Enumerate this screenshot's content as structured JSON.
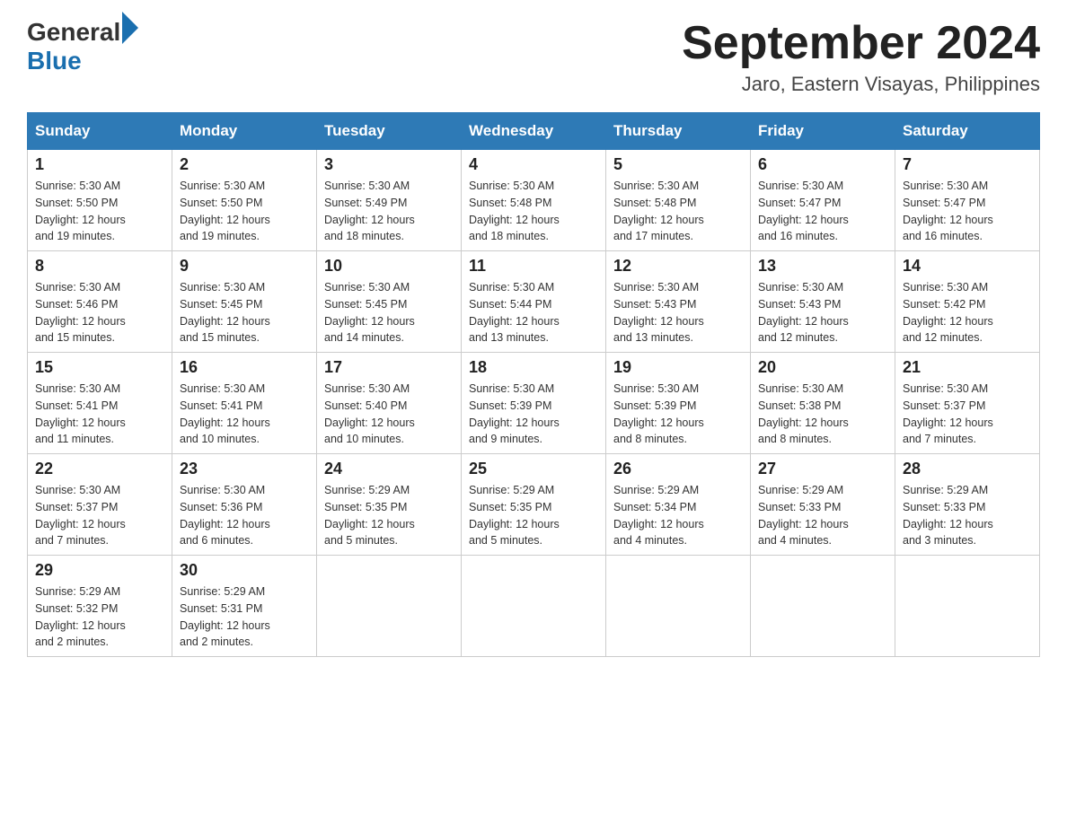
{
  "header": {
    "logo_general": "General",
    "logo_blue": "Blue",
    "title": "September 2024",
    "subtitle": "Jaro, Eastern Visayas, Philippines"
  },
  "columns": [
    "Sunday",
    "Monday",
    "Tuesday",
    "Wednesday",
    "Thursday",
    "Friday",
    "Saturday"
  ],
  "weeks": [
    [
      {
        "day": "1",
        "sunrise": "5:30 AM",
        "sunset": "5:50 PM",
        "daylight": "12 hours and 19 minutes."
      },
      {
        "day": "2",
        "sunrise": "5:30 AM",
        "sunset": "5:50 PM",
        "daylight": "12 hours and 19 minutes."
      },
      {
        "day": "3",
        "sunrise": "5:30 AM",
        "sunset": "5:49 PM",
        "daylight": "12 hours and 18 minutes."
      },
      {
        "day": "4",
        "sunrise": "5:30 AM",
        "sunset": "5:48 PM",
        "daylight": "12 hours and 18 minutes."
      },
      {
        "day": "5",
        "sunrise": "5:30 AM",
        "sunset": "5:48 PM",
        "daylight": "12 hours and 17 minutes."
      },
      {
        "day": "6",
        "sunrise": "5:30 AM",
        "sunset": "5:47 PM",
        "daylight": "12 hours and 16 minutes."
      },
      {
        "day": "7",
        "sunrise": "5:30 AM",
        "sunset": "5:47 PM",
        "daylight": "12 hours and 16 minutes."
      }
    ],
    [
      {
        "day": "8",
        "sunrise": "5:30 AM",
        "sunset": "5:46 PM",
        "daylight": "12 hours and 15 minutes."
      },
      {
        "day": "9",
        "sunrise": "5:30 AM",
        "sunset": "5:45 PM",
        "daylight": "12 hours and 15 minutes."
      },
      {
        "day": "10",
        "sunrise": "5:30 AM",
        "sunset": "5:45 PM",
        "daylight": "12 hours and 14 minutes."
      },
      {
        "day": "11",
        "sunrise": "5:30 AM",
        "sunset": "5:44 PM",
        "daylight": "12 hours and 13 minutes."
      },
      {
        "day": "12",
        "sunrise": "5:30 AM",
        "sunset": "5:43 PM",
        "daylight": "12 hours and 13 minutes."
      },
      {
        "day": "13",
        "sunrise": "5:30 AM",
        "sunset": "5:43 PM",
        "daylight": "12 hours and 12 minutes."
      },
      {
        "day": "14",
        "sunrise": "5:30 AM",
        "sunset": "5:42 PM",
        "daylight": "12 hours and 12 minutes."
      }
    ],
    [
      {
        "day": "15",
        "sunrise": "5:30 AM",
        "sunset": "5:41 PM",
        "daylight": "12 hours and 11 minutes."
      },
      {
        "day": "16",
        "sunrise": "5:30 AM",
        "sunset": "5:41 PM",
        "daylight": "12 hours and 10 minutes."
      },
      {
        "day": "17",
        "sunrise": "5:30 AM",
        "sunset": "5:40 PM",
        "daylight": "12 hours and 10 minutes."
      },
      {
        "day": "18",
        "sunrise": "5:30 AM",
        "sunset": "5:39 PM",
        "daylight": "12 hours and 9 minutes."
      },
      {
        "day": "19",
        "sunrise": "5:30 AM",
        "sunset": "5:39 PM",
        "daylight": "12 hours and 8 minutes."
      },
      {
        "day": "20",
        "sunrise": "5:30 AM",
        "sunset": "5:38 PM",
        "daylight": "12 hours and 8 minutes."
      },
      {
        "day": "21",
        "sunrise": "5:30 AM",
        "sunset": "5:37 PM",
        "daylight": "12 hours and 7 minutes."
      }
    ],
    [
      {
        "day": "22",
        "sunrise": "5:30 AM",
        "sunset": "5:37 PM",
        "daylight": "12 hours and 7 minutes."
      },
      {
        "day": "23",
        "sunrise": "5:30 AM",
        "sunset": "5:36 PM",
        "daylight": "12 hours and 6 minutes."
      },
      {
        "day": "24",
        "sunrise": "5:29 AM",
        "sunset": "5:35 PM",
        "daylight": "12 hours and 5 minutes."
      },
      {
        "day": "25",
        "sunrise": "5:29 AM",
        "sunset": "5:35 PM",
        "daylight": "12 hours and 5 minutes."
      },
      {
        "day": "26",
        "sunrise": "5:29 AM",
        "sunset": "5:34 PM",
        "daylight": "12 hours and 4 minutes."
      },
      {
        "day": "27",
        "sunrise": "5:29 AM",
        "sunset": "5:33 PM",
        "daylight": "12 hours and 4 minutes."
      },
      {
        "day": "28",
        "sunrise": "5:29 AM",
        "sunset": "5:33 PM",
        "daylight": "12 hours and 3 minutes."
      }
    ],
    [
      {
        "day": "29",
        "sunrise": "5:29 AM",
        "sunset": "5:32 PM",
        "daylight": "12 hours and 2 minutes."
      },
      {
        "day": "30",
        "sunrise": "5:29 AM",
        "sunset": "5:31 PM",
        "daylight": "12 hours and 2 minutes."
      },
      null,
      null,
      null,
      null,
      null
    ]
  ],
  "labels": {
    "sunrise": "Sunrise:",
    "sunset": "Sunset:",
    "daylight": "Daylight:"
  }
}
